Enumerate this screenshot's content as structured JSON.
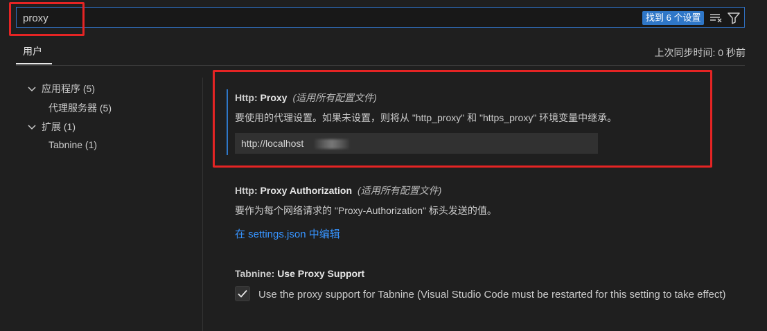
{
  "search": {
    "value": "proxy",
    "result_badge": "找到 6 个设置",
    "clear_icon": "clear-filter-icon",
    "filter_icon": "filter-icon"
  },
  "tabs": {
    "active": "用户",
    "sync_status": "上次同步时间: 0 秒前"
  },
  "toc": [
    {
      "label": "应用程序 (5)",
      "expanded": true
    },
    {
      "label": "代理服务器 (5)"
    },
    {
      "label": "扩展 (1)",
      "expanded": true
    },
    {
      "label": "Tabnine (1)"
    }
  ],
  "settings": [
    {
      "category": "Http: ",
      "key": "Proxy",
      "scope": "(适用所有配置文件)",
      "description": "要使用的代理设置。如果未设置，则将从 \"http_proxy\" 和 \"https_proxy\" 环境变量中继承。",
      "value": "http://localhost"
    },
    {
      "category": "Http: ",
      "key": "Proxy Authorization",
      "scope": "(适用所有配置文件)",
      "description": "要作为每个网络请求的 \"Proxy-Authorization\" 标头发送的值。",
      "link": "在 settings.json 中编辑"
    },
    {
      "category": "Tabnine: ",
      "key": "Use Proxy Support",
      "checkbox_label": "Use the proxy support for Tabnine (Visual Studio Code must be restarted for this setting to take effect)",
      "checked": true
    }
  ],
  "colors": {
    "accent": "#2f77c8",
    "link": "#3794ff",
    "annotation": "#e52424",
    "background": "#1f1f1f"
  }
}
